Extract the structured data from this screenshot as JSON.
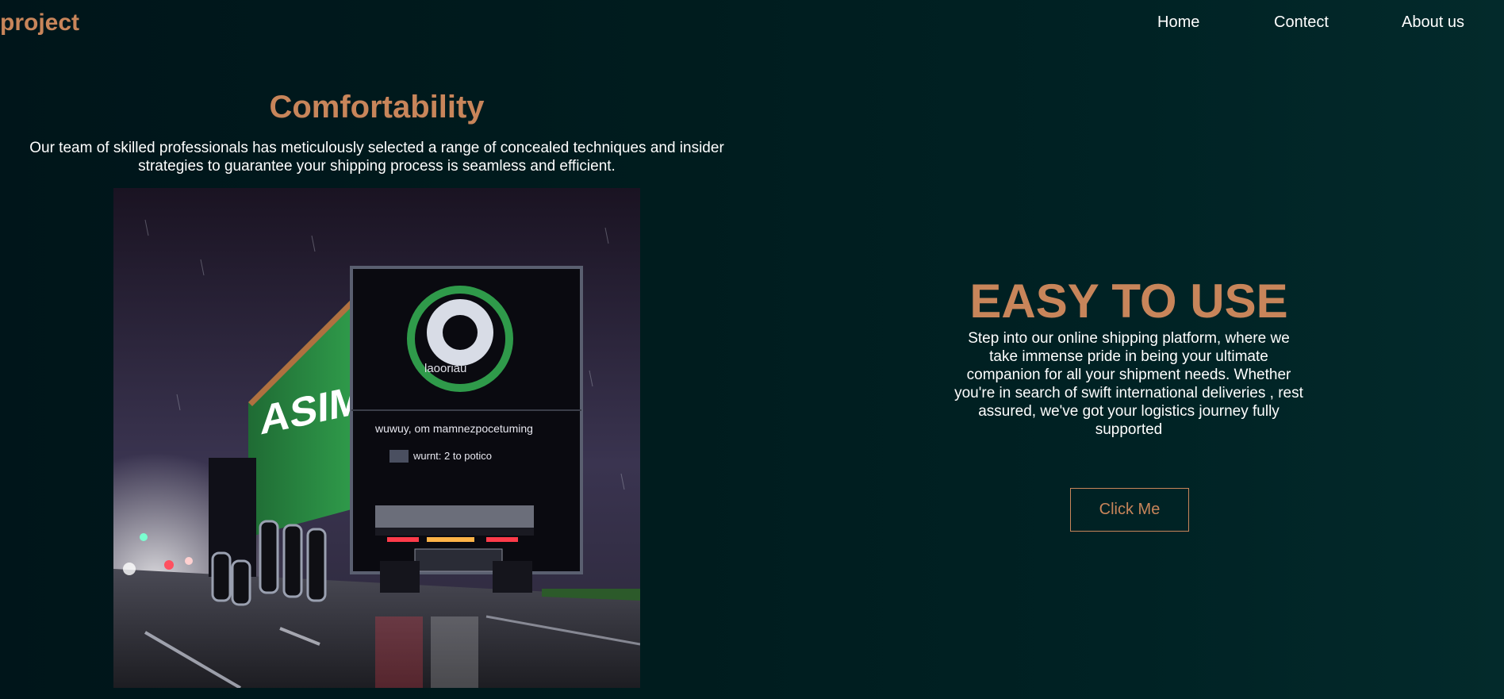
{
  "header": {
    "logo": "project",
    "nav": [
      "Home",
      "Contect",
      "About us"
    ]
  },
  "features": {
    "comfort": {
      "title": "Comfortability",
      "text": "Our team of skilled professionals has meticulously selected a range of concealed techniques and insider strategies to guarantee your shipping process is seamless and efficient.",
      "image": {
        "trailer_side_text": "ASIMANI",
        "door_text_1": "wuwuy, om mamnezpocetuming",
        "door_text_2": "wurnt: 2 to potico",
        "logo_text": "laooriau"
      }
    },
    "easy": {
      "title": "EASY TO USE",
      "text": "Step into our online shipping platform, where we take immense pride in being your ultimate companion for all your shipment needs. Whether you're in search of swift international deliveries , rest assured, we've got your logistics journey fully supported",
      "button_label": "Click Me"
    }
  },
  "colors": {
    "accent": "#c8855a",
    "background_dark": "#00151a",
    "background_light": "#032a2b",
    "text": "#ffffff"
  }
}
